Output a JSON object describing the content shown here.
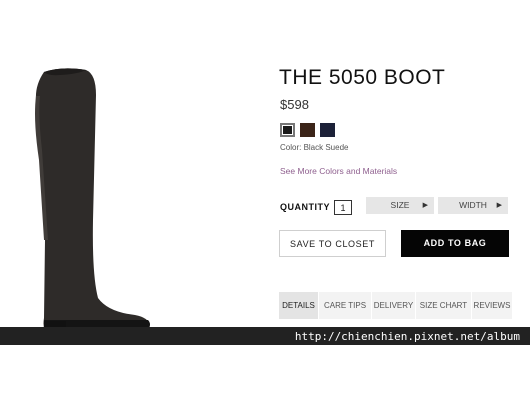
{
  "product": {
    "title": "THE 5050 BOOT",
    "price": "$598",
    "color_label": "Color: Black Suede",
    "more_colors_link": "See More Colors and Materials",
    "swatches": [
      {
        "name": "black",
        "color": "#1a1a1a",
        "selected": true
      },
      {
        "name": "brown",
        "color": "#3b2418",
        "selected": false
      },
      {
        "name": "navy",
        "color": "#1c2138",
        "selected": false
      }
    ]
  },
  "purchase": {
    "quantity_label": "QUANTITY",
    "quantity_value": "1",
    "size_label": "SIZE",
    "width_label": "WIDTH",
    "save_label": "SAVE TO CLOSET",
    "add_label": "ADD TO BAG"
  },
  "tabs": [
    {
      "label": "DETAILS",
      "active": true
    },
    {
      "label": "CARE TIPS",
      "active": false
    },
    {
      "label": "DELIVERY",
      "active": false
    },
    {
      "label": "SIZE CHART",
      "active": false
    },
    {
      "label": "REVIEWS",
      "active": false
    }
  ],
  "icons": {
    "dropdown": "triangle-right-icon"
  },
  "watermark": "http://chienchien.pixnet.net/album"
}
